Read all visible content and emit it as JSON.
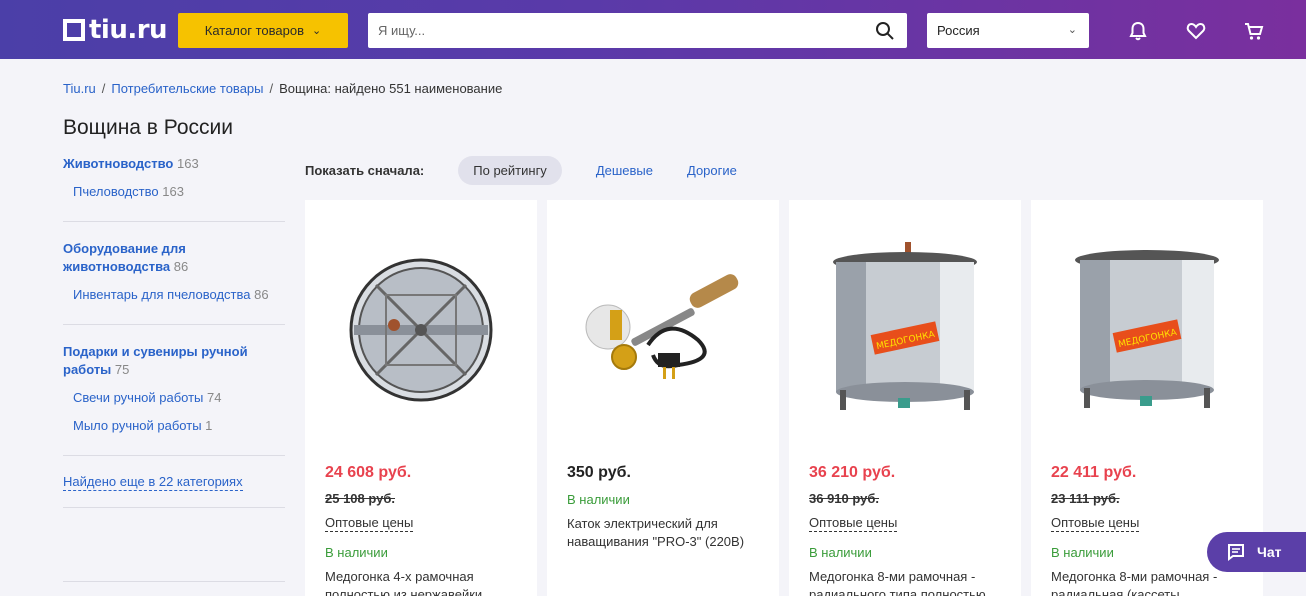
{
  "header": {
    "logo": "tiu.ru",
    "catalog_label": "Каталог товаров",
    "search_placeholder": "Я ищу...",
    "region": "Россия"
  },
  "breadcrumb": {
    "home": "Tiu.ru",
    "category": "Потребительские товары",
    "current": "Вощина: найдено 551 наименование"
  },
  "page_title": "Вощина в России",
  "sidebar": {
    "groups": [
      {
        "name": "Животноводство",
        "count": "163",
        "subs": [
          {
            "name": "Пчеловодство",
            "count": "163"
          }
        ]
      },
      {
        "name": "Оборудование для животноводства",
        "count": "86",
        "subs": [
          {
            "name": "Инвентарь для пчеловодства",
            "count": "86"
          }
        ]
      },
      {
        "name": "Подарки и сувениры ручной работы",
        "count": "75",
        "subs": [
          {
            "name": "Свечи ручной работы",
            "count": "74"
          },
          {
            "name": "Мыло ручной работы",
            "count": "1"
          }
        ]
      }
    ],
    "more_label": "Найдено еще в 22 категориях"
  },
  "sort": {
    "label": "Показать сначала:",
    "options": [
      "По рейтингу",
      "Дешевые",
      "Дорогие"
    ]
  },
  "products": [
    {
      "price": "24 608 руб.",
      "old_price": "25 108 руб.",
      "wholesale": "Оптовые цены",
      "stock": "В наличии",
      "name": "Медогонка 4-х рамочная полностью из нержавейки"
    },
    {
      "price": "350 руб.",
      "stock": "В наличии",
      "name": "Каток электрический для наващивания \"PRO-3\" (220В)"
    },
    {
      "price": "36 210 руб.",
      "old_price": "36 910 руб.",
      "wholesale": "Оптовые цены",
      "stock": "В наличии",
      "name": "Медогонка 8-ми рамочная - радиального типа полностью"
    },
    {
      "price": "22 411 руб.",
      "old_price": "23 111 руб.",
      "wholesale": "Оптовые цены",
      "stock": "В наличии",
      "name": "Медогонка 8-ми рамочная - радиальная (кассеты"
    }
  ],
  "chat_label": "Чат",
  "colors": {
    "accent": "#5b3fa8",
    "catalog": "#f6c200",
    "price": "#e8424e",
    "link": "#2a63c9",
    "stock": "#3a9c3a"
  }
}
